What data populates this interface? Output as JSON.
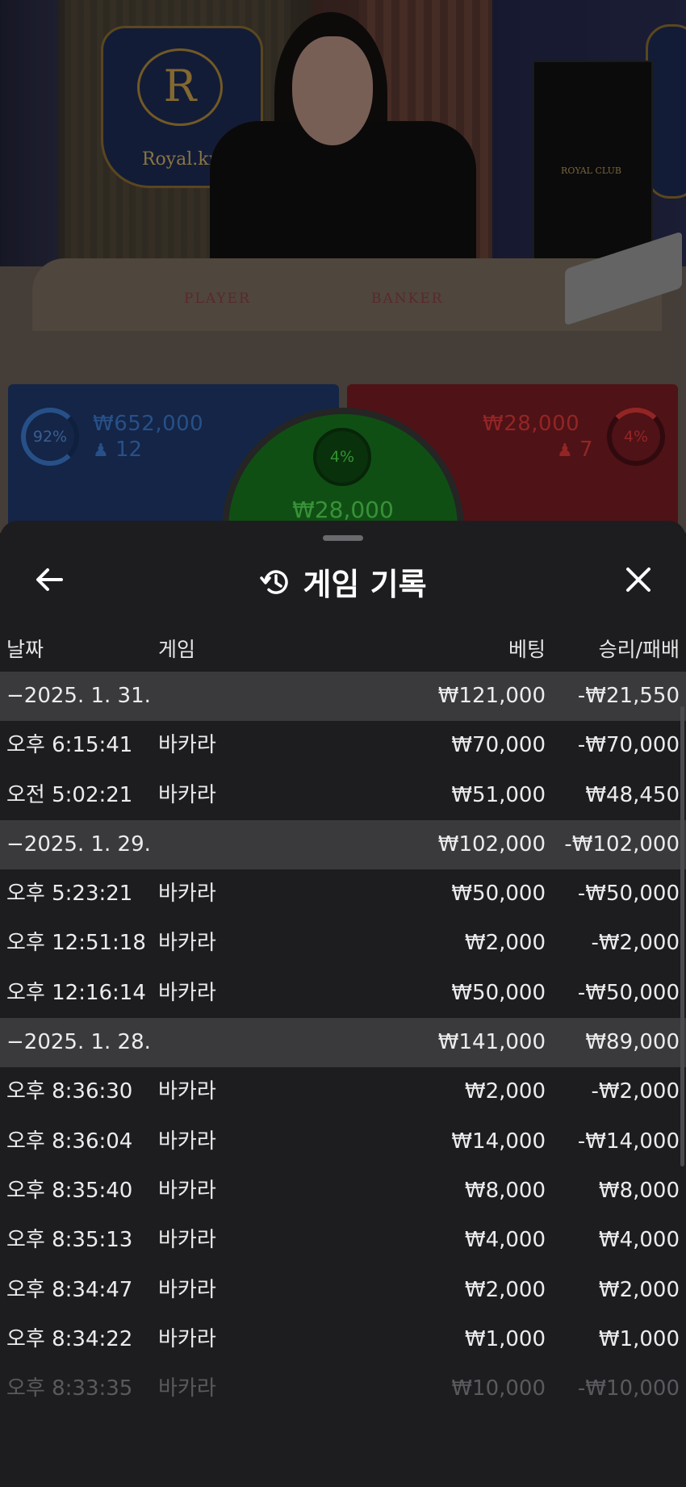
{
  "video": {
    "logo_text": "Royal.kr",
    "logo_letter": "R",
    "club_sign": "ROYAL CLUB",
    "table_player_label": "PLAYER",
    "table_banker_label": "BANKER"
  },
  "bets": {
    "player": {
      "percent": "92%",
      "amount": "₩652,000",
      "count": "12",
      "color": "#3d7bd2"
    },
    "tie": {
      "percent": "4%",
      "amount": "₩28,000",
      "color": "#56e056"
    },
    "banker": {
      "percent": "4%",
      "amount": "₩28,000",
      "count": "7",
      "color": "#e23a3a"
    }
  },
  "sheet": {
    "title": "게임 기록",
    "columns": {
      "date": "날짜",
      "game": "게임",
      "bet": "베팅",
      "result": "승리/패배"
    },
    "rows": [
      {
        "type": "date",
        "time": "−2025. 1. 31.",
        "game": "",
        "bet": "₩121,000",
        "result": "-₩21,550"
      },
      {
        "type": "item",
        "time": "오후 6:15:41",
        "game": "바카라",
        "bet": "₩70,000",
        "result": "-₩70,000"
      },
      {
        "type": "item",
        "time": "오전 5:02:21",
        "game": "바카라",
        "bet": "₩51,000",
        "result": "₩48,450"
      },
      {
        "type": "date",
        "time": "−2025. 1. 29.",
        "game": "",
        "bet": "₩102,000",
        "result": "-₩102,000"
      },
      {
        "type": "item",
        "time": "오후 5:23:21",
        "game": "바카라",
        "bet": "₩50,000",
        "result": "-₩50,000"
      },
      {
        "type": "item",
        "time": "오후 12:51:18",
        "game": "바카라",
        "bet": "₩2,000",
        "result": "-₩2,000"
      },
      {
        "type": "item",
        "time": "오후 12:16:14",
        "game": "바카라",
        "bet": "₩50,000",
        "result": "-₩50,000"
      },
      {
        "type": "date",
        "time": "−2025. 1. 28.",
        "game": "",
        "bet": "₩141,000",
        "result": "₩89,000"
      },
      {
        "type": "item",
        "time": "오후 8:36:30",
        "game": "바카라",
        "bet": "₩2,000",
        "result": "-₩2,000"
      },
      {
        "type": "item",
        "time": "오후 8:36:04",
        "game": "바카라",
        "bet": "₩14,000",
        "result": "-₩14,000"
      },
      {
        "type": "item",
        "time": "오후 8:35:40",
        "game": "바카라",
        "bet": "₩8,000",
        "result": "₩8,000"
      },
      {
        "type": "item",
        "time": "오후 8:35:13",
        "game": "바카라",
        "bet": "₩4,000",
        "result": "₩4,000"
      },
      {
        "type": "item",
        "time": "오후 8:34:47",
        "game": "바카라",
        "bet": "₩2,000",
        "result": "₩2,000"
      },
      {
        "type": "item",
        "time": "오후 8:34:22",
        "game": "바카라",
        "bet": "₩1,000",
        "result": "₩1,000"
      },
      {
        "type": "item-faded",
        "time": "오후 8:33:35",
        "game": "바카라",
        "bet": "₩10,000",
        "result": "-₩10,000"
      }
    ]
  }
}
